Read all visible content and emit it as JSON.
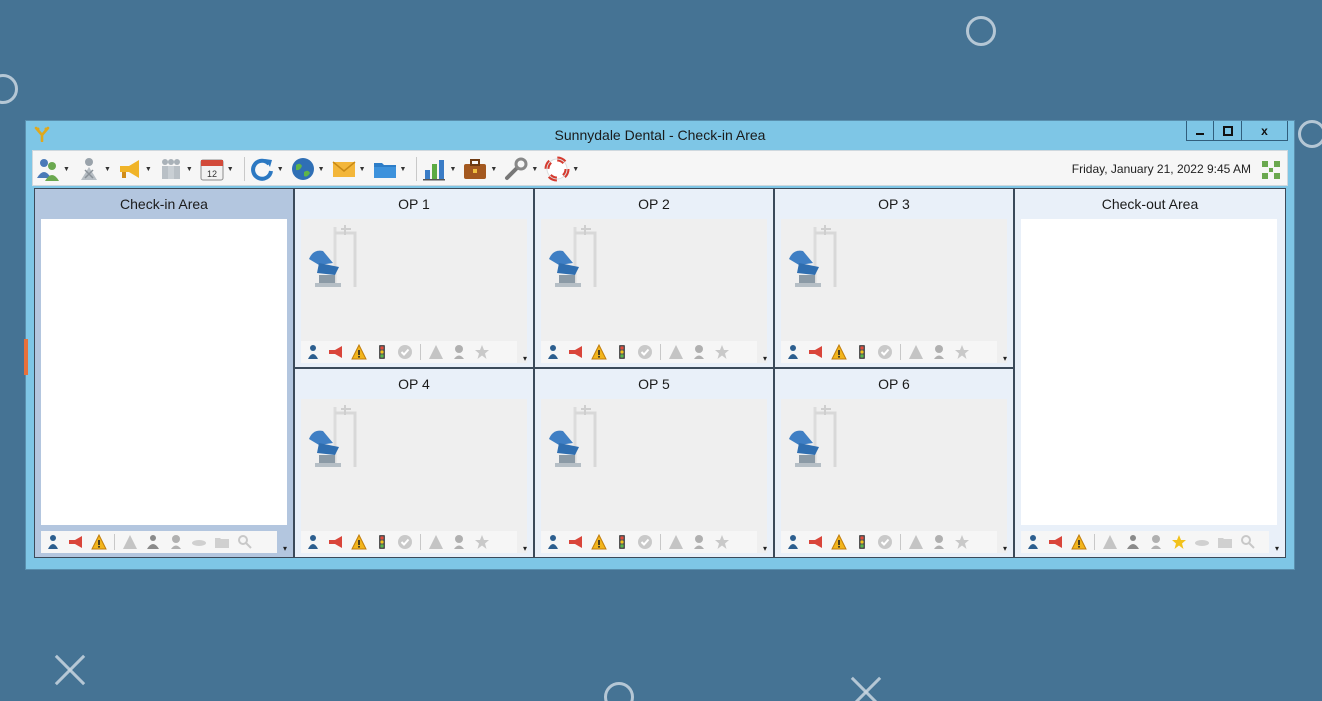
{
  "window": {
    "title": "Sunnydale Dental - Check-in Area",
    "controls": {
      "minimize": "▁",
      "maximize": "▢",
      "close": "x"
    }
  },
  "toolbar": {
    "buttons": [
      {
        "icon": "patients-icon",
        "has_dropdown": true
      },
      {
        "icon": "provider-icon",
        "has_dropdown": true
      },
      {
        "icon": "megaphone-icon",
        "has_dropdown": true
      },
      {
        "icon": "staff-icon",
        "has_dropdown": true
      },
      {
        "icon": "calendar-icon",
        "label": "12",
        "has_dropdown": true
      },
      {
        "icon": "refresh-icon",
        "has_dropdown": true
      },
      {
        "icon": "globe-icon",
        "has_dropdown": true
      },
      {
        "icon": "mail-icon",
        "has_dropdown": true
      },
      {
        "icon": "folder-icon",
        "has_dropdown": true
      },
      {
        "icon": "chart-icon",
        "has_dropdown": true
      },
      {
        "icon": "briefcase-icon",
        "has_dropdown": true
      },
      {
        "icon": "wrench-icon",
        "has_dropdown": true
      },
      {
        "icon": "lifebuoy-icon",
        "has_dropdown": true
      }
    ],
    "datetime": "Friday, January 21, 2022 9:45 AM"
  },
  "areas": {
    "checkin": {
      "title": "Check-in Area"
    },
    "checkout": {
      "title": "Check-out Area"
    }
  },
  "ops": [
    {
      "title": "OP 1"
    },
    {
      "title": "OP 2"
    },
    {
      "title": "OP 3"
    },
    {
      "title": "OP 4"
    },
    {
      "title": "OP 5"
    },
    {
      "title": "OP 6"
    }
  ],
  "colors": {
    "desktop": "#457394",
    "window_frame": "#7ec6e6",
    "checkin_header": "#b3c6df",
    "op_header": "#e9f0f9",
    "warning": "#f2b51c"
  }
}
